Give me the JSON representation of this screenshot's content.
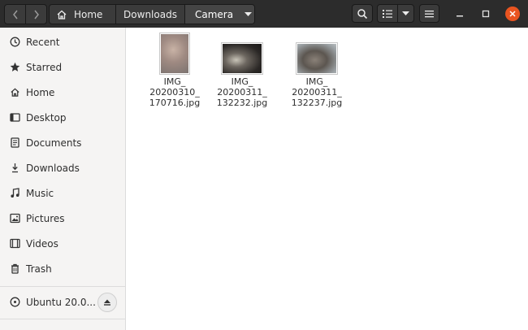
{
  "breadcrumbs": [
    {
      "label": "Home",
      "icon": "home-icon"
    },
    {
      "label": "Downloads"
    },
    {
      "label": "Camera",
      "active": true
    }
  ],
  "sidebar": {
    "items": [
      {
        "label": "Recent",
        "icon": "clock-icon"
      },
      {
        "label": "Starred",
        "icon": "star-icon"
      },
      {
        "label": "Home",
        "icon": "home-icon"
      },
      {
        "label": "Desktop",
        "icon": "desktop-icon"
      },
      {
        "label": "Documents",
        "icon": "document-icon"
      },
      {
        "label": "Downloads",
        "icon": "download-icon"
      },
      {
        "label": "Music",
        "icon": "music-icon"
      },
      {
        "label": "Pictures",
        "icon": "picture-icon"
      },
      {
        "label": "Videos",
        "icon": "film-icon"
      },
      {
        "label": "Trash",
        "icon": "trash-icon"
      }
    ],
    "devices": [
      {
        "label": "Ubuntu 20.0...",
        "icon": "disc-icon"
      }
    ]
  },
  "files": [
    {
      "line1": "IMG_",
      "line2": "20200310_",
      "line3": "170716.jpg"
    },
    {
      "line1": "IMG_",
      "line2": "20200311_",
      "line3": "132232.jpg"
    },
    {
      "line1": "IMG_",
      "line2": "20200311_",
      "line3": "132237.jpg"
    }
  ],
  "colors": {
    "headerbar": "#2c2c2c",
    "sidebar": "#f5f4f3",
    "close_button": "#e95420"
  }
}
